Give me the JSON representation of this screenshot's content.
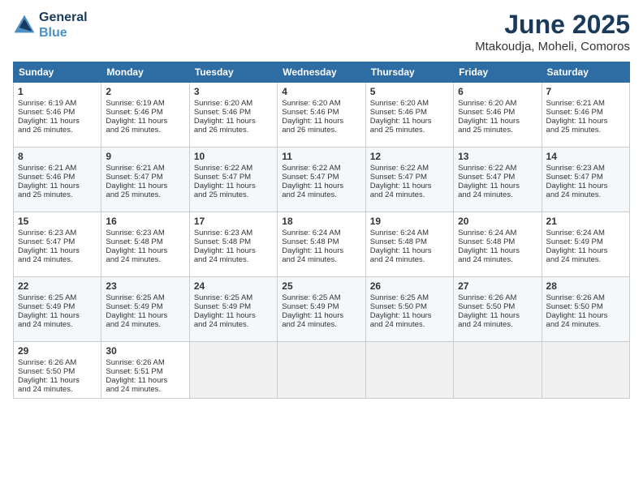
{
  "header": {
    "logo_line1": "General",
    "logo_line2": "Blue",
    "title": "June 2025",
    "subtitle": "Mtakoudja, Moheli, Comoros"
  },
  "weekdays": [
    "Sunday",
    "Monday",
    "Tuesday",
    "Wednesday",
    "Thursday",
    "Friday",
    "Saturday"
  ],
  "weeks": [
    [
      {
        "day": "1",
        "lines": [
          "Sunrise: 6:19 AM",
          "Sunset: 5:46 PM",
          "Daylight: 11 hours",
          "and 26 minutes."
        ]
      },
      {
        "day": "2",
        "lines": [
          "Sunrise: 6:19 AM",
          "Sunset: 5:46 PM",
          "Daylight: 11 hours",
          "and 26 minutes."
        ]
      },
      {
        "day": "3",
        "lines": [
          "Sunrise: 6:20 AM",
          "Sunset: 5:46 PM",
          "Daylight: 11 hours",
          "and 26 minutes."
        ]
      },
      {
        "day": "4",
        "lines": [
          "Sunrise: 6:20 AM",
          "Sunset: 5:46 PM",
          "Daylight: 11 hours",
          "and 26 minutes."
        ]
      },
      {
        "day": "5",
        "lines": [
          "Sunrise: 6:20 AM",
          "Sunset: 5:46 PM",
          "Daylight: 11 hours",
          "and 25 minutes."
        ]
      },
      {
        "day": "6",
        "lines": [
          "Sunrise: 6:20 AM",
          "Sunset: 5:46 PM",
          "Daylight: 11 hours",
          "and 25 minutes."
        ]
      },
      {
        "day": "7",
        "lines": [
          "Sunrise: 6:21 AM",
          "Sunset: 5:46 PM",
          "Daylight: 11 hours",
          "and 25 minutes."
        ]
      }
    ],
    [
      {
        "day": "8",
        "lines": [
          "Sunrise: 6:21 AM",
          "Sunset: 5:46 PM",
          "Daylight: 11 hours",
          "and 25 minutes."
        ]
      },
      {
        "day": "9",
        "lines": [
          "Sunrise: 6:21 AM",
          "Sunset: 5:47 PM",
          "Daylight: 11 hours",
          "and 25 minutes."
        ]
      },
      {
        "day": "10",
        "lines": [
          "Sunrise: 6:22 AM",
          "Sunset: 5:47 PM",
          "Daylight: 11 hours",
          "and 25 minutes."
        ]
      },
      {
        "day": "11",
        "lines": [
          "Sunrise: 6:22 AM",
          "Sunset: 5:47 PM",
          "Daylight: 11 hours",
          "and 24 minutes."
        ]
      },
      {
        "day": "12",
        "lines": [
          "Sunrise: 6:22 AM",
          "Sunset: 5:47 PM",
          "Daylight: 11 hours",
          "and 24 minutes."
        ]
      },
      {
        "day": "13",
        "lines": [
          "Sunrise: 6:22 AM",
          "Sunset: 5:47 PM",
          "Daylight: 11 hours",
          "and 24 minutes."
        ]
      },
      {
        "day": "14",
        "lines": [
          "Sunrise: 6:23 AM",
          "Sunset: 5:47 PM",
          "Daylight: 11 hours",
          "and 24 minutes."
        ]
      }
    ],
    [
      {
        "day": "15",
        "lines": [
          "Sunrise: 6:23 AM",
          "Sunset: 5:47 PM",
          "Daylight: 11 hours",
          "and 24 minutes."
        ]
      },
      {
        "day": "16",
        "lines": [
          "Sunrise: 6:23 AM",
          "Sunset: 5:48 PM",
          "Daylight: 11 hours",
          "and 24 minutes."
        ]
      },
      {
        "day": "17",
        "lines": [
          "Sunrise: 6:23 AM",
          "Sunset: 5:48 PM",
          "Daylight: 11 hours",
          "and 24 minutes."
        ]
      },
      {
        "day": "18",
        "lines": [
          "Sunrise: 6:24 AM",
          "Sunset: 5:48 PM",
          "Daylight: 11 hours",
          "and 24 minutes."
        ]
      },
      {
        "day": "19",
        "lines": [
          "Sunrise: 6:24 AM",
          "Sunset: 5:48 PM",
          "Daylight: 11 hours",
          "and 24 minutes."
        ]
      },
      {
        "day": "20",
        "lines": [
          "Sunrise: 6:24 AM",
          "Sunset: 5:48 PM",
          "Daylight: 11 hours",
          "and 24 minutes."
        ]
      },
      {
        "day": "21",
        "lines": [
          "Sunrise: 6:24 AM",
          "Sunset: 5:49 PM",
          "Daylight: 11 hours",
          "and 24 minutes."
        ]
      }
    ],
    [
      {
        "day": "22",
        "lines": [
          "Sunrise: 6:25 AM",
          "Sunset: 5:49 PM",
          "Daylight: 11 hours",
          "and 24 minutes."
        ]
      },
      {
        "day": "23",
        "lines": [
          "Sunrise: 6:25 AM",
          "Sunset: 5:49 PM",
          "Daylight: 11 hours",
          "and 24 minutes."
        ]
      },
      {
        "day": "24",
        "lines": [
          "Sunrise: 6:25 AM",
          "Sunset: 5:49 PM",
          "Daylight: 11 hours",
          "and 24 minutes."
        ]
      },
      {
        "day": "25",
        "lines": [
          "Sunrise: 6:25 AM",
          "Sunset: 5:49 PM",
          "Daylight: 11 hours",
          "and 24 minutes."
        ]
      },
      {
        "day": "26",
        "lines": [
          "Sunrise: 6:25 AM",
          "Sunset: 5:50 PM",
          "Daylight: 11 hours",
          "and 24 minutes."
        ]
      },
      {
        "day": "27",
        "lines": [
          "Sunrise: 6:26 AM",
          "Sunset: 5:50 PM",
          "Daylight: 11 hours",
          "and 24 minutes."
        ]
      },
      {
        "day": "28",
        "lines": [
          "Sunrise: 6:26 AM",
          "Sunset: 5:50 PM",
          "Daylight: 11 hours",
          "and 24 minutes."
        ]
      }
    ],
    [
      {
        "day": "29",
        "lines": [
          "Sunrise: 6:26 AM",
          "Sunset: 5:50 PM",
          "Daylight: 11 hours",
          "and 24 minutes."
        ]
      },
      {
        "day": "30",
        "lines": [
          "Sunrise: 6:26 AM",
          "Sunset: 5:51 PM",
          "Daylight: 11 hours",
          "and 24 minutes."
        ]
      },
      {
        "day": "",
        "lines": []
      },
      {
        "day": "",
        "lines": []
      },
      {
        "day": "",
        "lines": []
      },
      {
        "day": "",
        "lines": []
      },
      {
        "day": "",
        "lines": []
      }
    ]
  ]
}
